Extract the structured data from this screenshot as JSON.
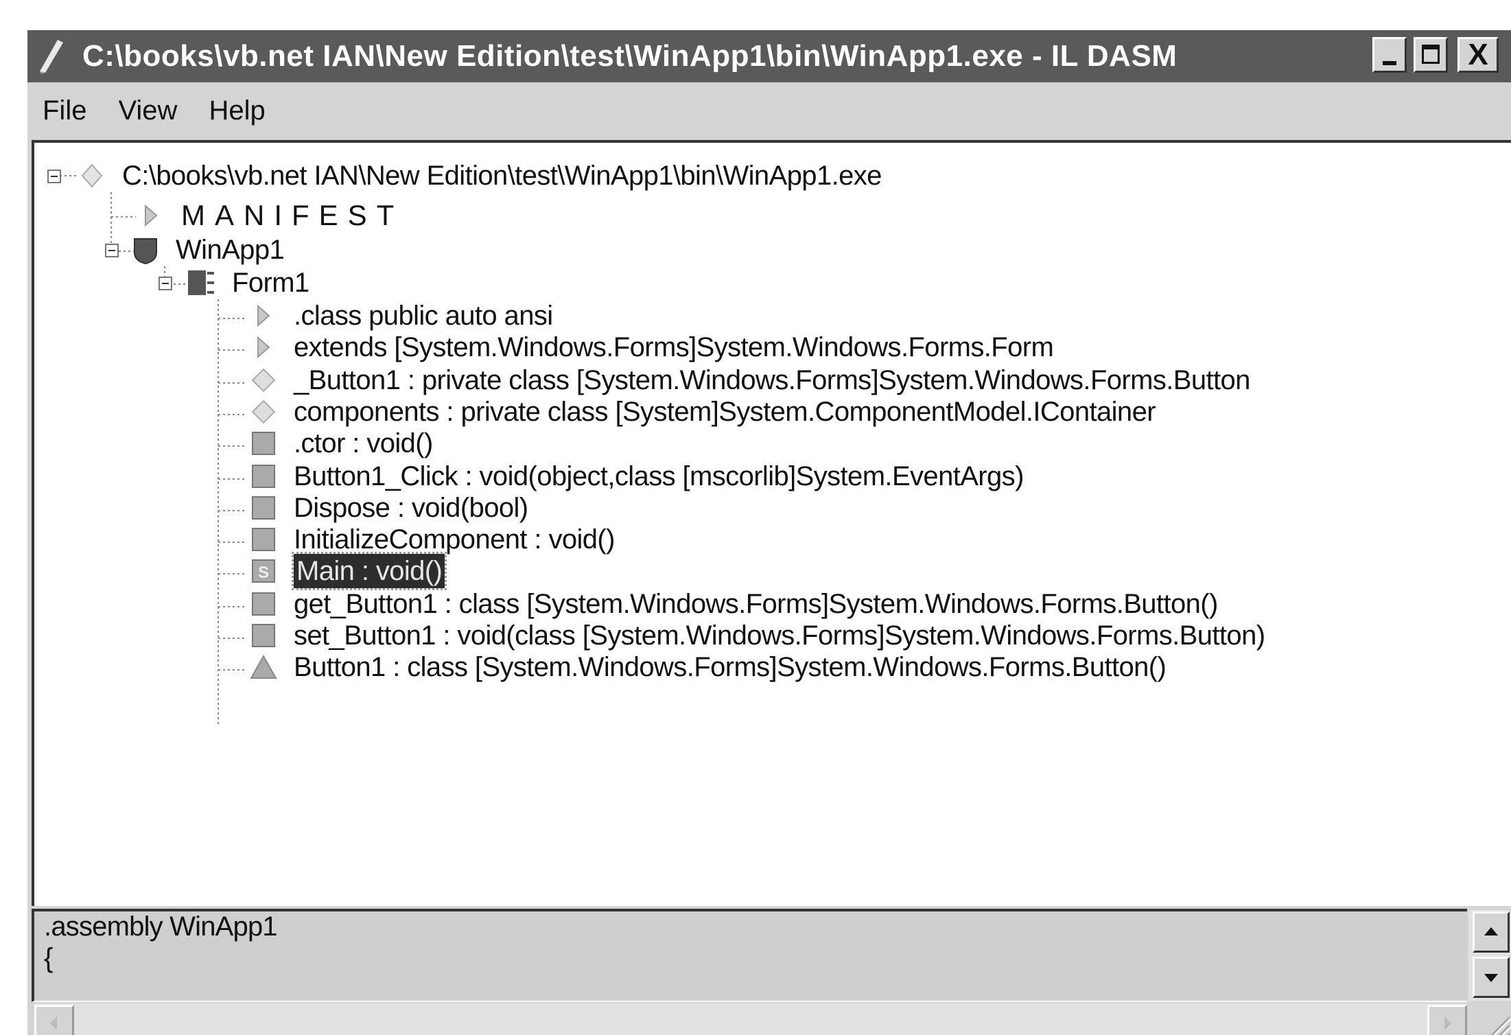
{
  "window": {
    "title": "C:\\books\\vb.net IAN\\New Edition\\test\\WinApp1\\bin\\WinApp1.exe - IL DASM",
    "controls": {
      "minimize": "minimize",
      "maximize": "maximize",
      "close": "X"
    }
  },
  "menu": {
    "items": [
      "File",
      "View",
      "Help"
    ]
  },
  "tree": {
    "nodes": [
      {
        "label": "C:\\books\\vb.net IAN\\New Edition\\test\\WinApp1\\bin\\WinApp1.exe",
        "icon": "assembly-diamond-icon",
        "expander": "minus"
      },
      {
        "label": "MANIFEST",
        "icon": "triangle-right-icon"
      },
      {
        "label": "WinApp1",
        "icon": "namespace-shield-icon",
        "expander": "minus"
      },
      {
        "label": "Form1",
        "icon": "class-icon",
        "expander": "minus"
      },
      {
        "label": ".class public auto ansi",
        "icon": "triangle-right-icon"
      },
      {
        "label": "extends [System.Windows.Forms]System.Windows.Forms.Form",
        "icon": "triangle-right-icon"
      },
      {
        "label": "_Button1 : private class [System.Windows.Forms]System.Windows.Forms.Button",
        "icon": "field-diamond-icon"
      },
      {
        "label": "components : private class [System]System.ComponentModel.IContainer",
        "icon": "field-diamond-icon"
      },
      {
        "label": ".ctor : void()",
        "icon": "method-square-icon"
      },
      {
        "label": "Button1_Click : void(object,class [mscorlib]System.EventArgs)",
        "icon": "method-square-icon"
      },
      {
        "label": "Dispose : void(bool)",
        "icon": "method-square-icon"
      },
      {
        "label": "InitializeComponent : void()",
        "icon": "method-square-icon"
      },
      {
        "label": "Main : void()",
        "icon": "static-method-icon",
        "icon_text": "S",
        "selected": true
      },
      {
        "label": "get_Button1 : class [System.Windows.Forms]System.Windows.Forms.Button()",
        "icon": "method-square-icon"
      },
      {
        "label": "set_Button1 : void(class [System.Windows.Forms]System.Windows.Forms.Button)",
        "icon": "method-square-icon"
      },
      {
        "label": "Button1 : class [System.Windows.Forms]System.Windows.Forms.Button()",
        "icon": "property-triangle-icon"
      }
    ]
  },
  "disassembly": {
    "lines": [
      ".assembly WinApp1",
      "{"
    ]
  },
  "colors": {
    "titlebar": "#5a5a5a",
    "chrome": "#d4d4d4",
    "selection": "#2d2d2d",
    "icon_dark": "#555555",
    "icon_light": "#cfcfcf"
  }
}
